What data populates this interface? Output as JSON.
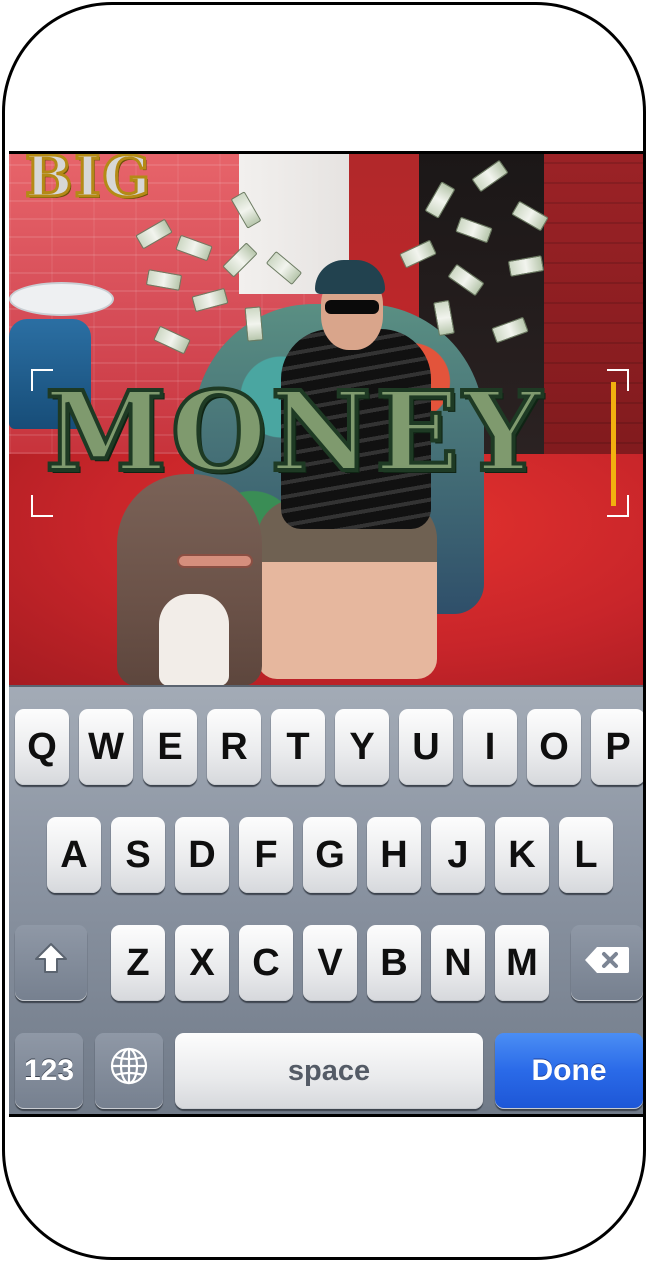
{
  "canvas": {
    "big_sticker_text": "BIG",
    "headline_text": "MONEY"
  },
  "keyboard": {
    "row1": [
      "Q",
      "W",
      "E",
      "R",
      "T",
      "Y",
      "U",
      "I",
      "O",
      "P"
    ],
    "row2": [
      "A",
      "S",
      "D",
      "F",
      "G",
      "H",
      "J",
      "K",
      "L"
    ],
    "row3": [
      "Z",
      "X",
      "C",
      "V",
      "B",
      "N",
      "M"
    ],
    "numbers_label": "123",
    "space_label": "space",
    "done_label": "Done"
  },
  "icons": {
    "shift": "shift-icon",
    "delete": "backspace-icon",
    "globe": "globe-icon"
  },
  "colors": {
    "done_blue": "#2a6ae8",
    "cursor_gold": "#f2b00f",
    "money_green": "#7f9a6e"
  }
}
